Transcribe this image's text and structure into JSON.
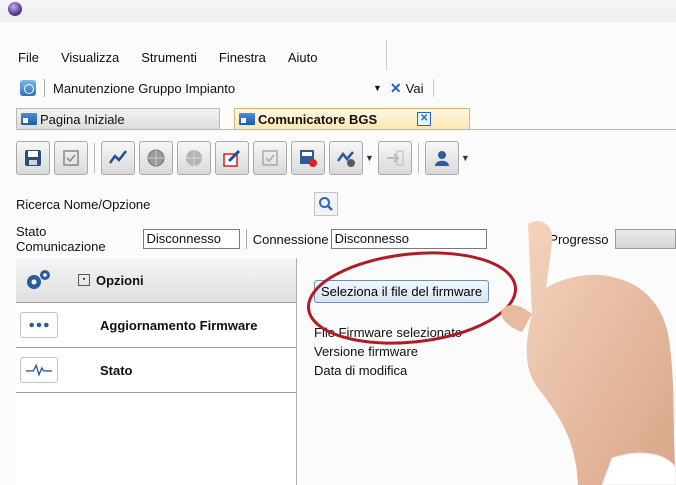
{
  "menu": [
    "File",
    "Visualizza",
    "Strumenti",
    "Finestra",
    "Aiuto"
  ],
  "address": {
    "text": "Manutenzione Gruppo Impianto",
    "go_label": "Vai"
  },
  "tabs": [
    {
      "label": "Pagina Iniziale",
      "active": false
    },
    {
      "label": "Comunicatore BGS",
      "active": true
    }
  ],
  "toolbar": {
    "buttons": [
      "save-icon",
      "checkbox-icon",
      "chart-line-icon",
      "globe-icon",
      "globe-disabled-icon",
      "edit-icon",
      "checkbox-disabled-icon",
      "download-icon",
      "wave-icon",
      "arrow-disabled-icon",
      "user-icon"
    ]
  },
  "search": {
    "label": "Ricerca Nome/Opzione"
  },
  "status": {
    "comm_label": "Stato Comunicazione",
    "comm_value": "Disconnesso",
    "conn_label": "Connessione",
    "conn_value": "Disconnesso",
    "progress_label": "Progresso"
  },
  "nav": [
    {
      "label": "Opzioni",
      "icon": "gears-icon"
    },
    {
      "label": "Aggiornamento Firmware",
      "icon": "dots-icon"
    },
    {
      "label": "Stato",
      "icon": "pulse-icon"
    }
  ],
  "content": {
    "button_label": "Seleziona il file del firmware",
    "info": [
      "File Firmware selezionato",
      "Versione firmware",
      "Data di modifica"
    ]
  },
  "colors": {
    "accent": "#2a67c1",
    "annotation": "#b01c24",
    "active_tab": "#fbe7b3"
  }
}
